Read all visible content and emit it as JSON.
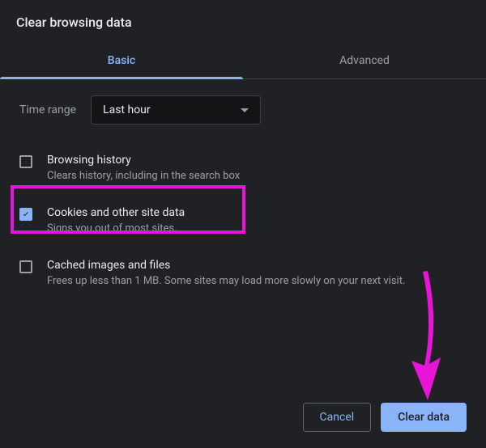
{
  "title": "Clear browsing data",
  "tabs": {
    "basic": "Basic",
    "advanced": "Advanced"
  },
  "time": {
    "label": "Time range",
    "value": "Last hour"
  },
  "options": [
    {
      "title": "Browsing history",
      "desc": "Clears history, including in the search box",
      "checked": false
    },
    {
      "title": "Cookies and other site data",
      "desc": "Signs you out of most sites.",
      "checked": true
    },
    {
      "title": "Cached images and files",
      "desc": "Frees up less than 1 MB. Some sites may load more slowly on your next visit.",
      "checked": false
    }
  ],
  "buttons": {
    "cancel": "Cancel",
    "clear": "Clear data"
  },
  "annotation": {
    "highlight_color": "#e815d8",
    "arrow_color": "#e815d8"
  }
}
